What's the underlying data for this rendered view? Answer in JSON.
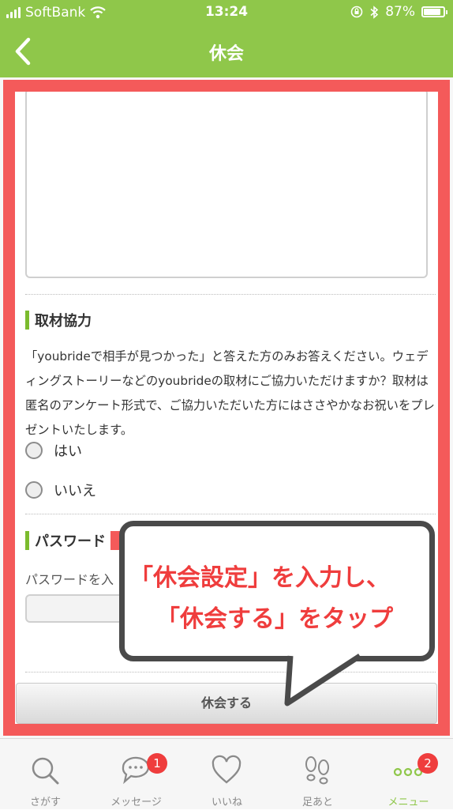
{
  "status_bar": {
    "carrier": "SoftBank",
    "time": "13:24",
    "battery": "87%",
    "battery_level": 0.87
  },
  "header": {
    "title": "休会"
  },
  "interview": {
    "title": "取材協力",
    "description": "「youbrideで相手が見つかった」と答えた方のみお答えください。ウェディングストーリーなどのyoubrideの取材にご協力いただけますか？取材は匿名のアンケート形式で、ご協力いただいた方にはささやかなお祝いをプレゼントいたします。",
    "options": [
      "はい",
      "いいえ"
    ]
  },
  "password": {
    "title": "パスワード",
    "label": "パスワードを入",
    "value": ""
  },
  "submit_label": "休会する",
  "callout": {
    "line1": "「休会設定」を入力し、",
    "line2": "「休会する」をタップ"
  },
  "tabbar": {
    "items": [
      {
        "label": "さがす",
        "icon": "search-icon"
      },
      {
        "label": "メッセージ",
        "icon": "message-icon",
        "badge": "1"
      },
      {
        "label": "いいね",
        "icon": "heart-icon"
      },
      {
        "label": "足あと",
        "icon": "footprints-icon"
      },
      {
        "label": "メニュー",
        "icon": "more-icon",
        "badge": "2"
      }
    ]
  },
  "colors": {
    "header": "#8fc74a",
    "accent": "#7bbb2e",
    "highlight": "#f45a5a",
    "callout_text": "#ef3d3d"
  }
}
